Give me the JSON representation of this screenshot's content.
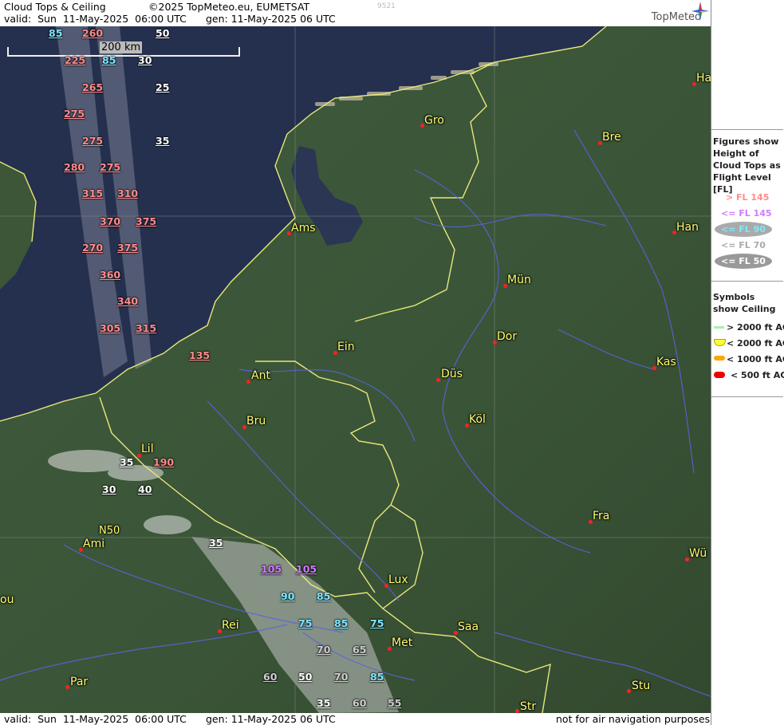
{
  "header": {
    "title": "Cloud Tops & Ceiling",
    "copyright": "©2025 TopMeteo.eu, EUMETSAT",
    "code": "9521",
    "valid": "valid:  Sun  11-May-2025  06:00 UTC",
    "gen": "gen: 11-May-2025 06 UTC",
    "logo_text": "TopMeteo"
  },
  "footer": {
    "valid": "valid:  Sun  11-May-2025  06:00 UTC",
    "gen": "gen: 11-May-2025 06 UTC",
    "disclaimer": "not for air navigation purposes"
  },
  "scale": {
    "label": "200 km"
  },
  "grid_label": "N50",
  "cities": [
    {
      "name": "Gro"
    },
    {
      "name": "Bre"
    },
    {
      "name": "Ha"
    },
    {
      "name": "Ams"
    },
    {
      "name": "Han"
    },
    {
      "name": "Mün"
    },
    {
      "name": "Dor"
    },
    {
      "name": "Ein"
    },
    {
      "name": "Ant"
    },
    {
      "name": "Düs"
    },
    {
      "name": "Kas"
    },
    {
      "name": "Köl"
    },
    {
      "name": "Bru"
    },
    {
      "name": "Lil"
    },
    {
      "name": "Fra"
    },
    {
      "name": "Ami"
    },
    {
      "name": "Wü"
    },
    {
      "name": "Lux"
    },
    {
      "name": "Saa"
    },
    {
      "name": "Rei"
    },
    {
      "name": "Met"
    },
    {
      "name": "ou"
    },
    {
      "name": "Par"
    },
    {
      "name": "Stu"
    },
    {
      "name": "Str"
    }
  ],
  "cloud_labels": [
    {
      "v": "85",
      "c": "cyan"
    },
    {
      "v": "260",
      "c": "pink"
    },
    {
      "v": "50",
      "c": "white"
    },
    {
      "v": "225",
      "c": "pink"
    },
    {
      "v": "85",
      "c": "cyan"
    },
    {
      "v": "30",
      "c": "white"
    },
    {
      "v": "265",
      "c": "pink"
    },
    {
      "v": "25",
      "c": "white"
    },
    {
      "v": "275",
      "c": "pink"
    },
    {
      "v": "275",
      "c": "pink"
    },
    {
      "v": "35",
      "c": "white"
    },
    {
      "v": "280",
      "c": "pink"
    },
    {
      "v": "275",
      "c": "pink"
    },
    {
      "v": "315",
      "c": "pink"
    },
    {
      "v": "310",
      "c": "pink"
    },
    {
      "v": "370",
      "c": "pink"
    },
    {
      "v": "375",
      "c": "pink"
    },
    {
      "v": "270",
      "c": "pink"
    },
    {
      "v": "375",
      "c": "pink"
    },
    {
      "v": "360",
      "c": "pink"
    },
    {
      "v": "340",
      "c": "pink"
    },
    {
      "v": "305",
      "c": "pink"
    },
    {
      "v": "315",
      "c": "pink"
    },
    {
      "v": "135",
      "c": "pink"
    },
    {
      "v": "35",
      "c": "white"
    },
    {
      "v": "190",
      "c": "pink"
    },
    {
      "v": "30",
      "c": "white"
    },
    {
      "v": "40",
      "c": "white"
    },
    {
      "v": "35",
      "c": "white"
    },
    {
      "v": "105",
      "c": "magenta"
    },
    {
      "v": "105",
      "c": "magenta"
    },
    {
      "v": "90",
      "c": "cyan"
    },
    {
      "v": "85",
      "c": "cyan"
    },
    {
      "v": "75",
      "c": "cyan"
    },
    {
      "v": "85",
      "c": "cyan"
    },
    {
      "v": "75",
      "c": "cyan"
    },
    {
      "v": "70",
      "c": "gray"
    },
    {
      "v": "65",
      "c": "gray"
    },
    {
      "v": "60",
      "c": "gray"
    },
    {
      "v": "50",
      "c": "white"
    },
    {
      "v": "70",
      "c": "gray"
    },
    {
      "v": "85",
      "c": "cyan"
    },
    {
      "v": "35",
      "c": "white"
    },
    {
      "v": "60",
      "c": "gray"
    },
    {
      "v": "55",
      "c": "gray"
    }
  ],
  "legend": {
    "tops_title": "Figures show Height of Cloud Tops as Flight Level  [FL]",
    "tops": [
      {
        "label": "> FL 145",
        "color": "#ff8c8c"
      },
      {
        "label": "<= FL 145",
        "color": "#d27aff"
      },
      {
        "label": "<= FL 90",
        "color": "#7fe8ff"
      },
      {
        "label": "<= FL 70",
        "color": "#aaaaaa"
      },
      {
        "label": "<= FL 50",
        "color": "#ffffff"
      }
    ],
    "ceiling_title": "Symbols show Ceiling",
    "ceiling": [
      {
        "label": "> 2000 ft AGL",
        "color": "#a8f0a8"
      },
      {
        "label": "< 2000 ft AGL",
        "color": "#ffff33"
      },
      {
        "label": "< 1000 ft AGL",
        "color": "#ffa500"
      },
      {
        "label": "< 500 ft AGL",
        "color": "#ee0000"
      }
    ]
  }
}
